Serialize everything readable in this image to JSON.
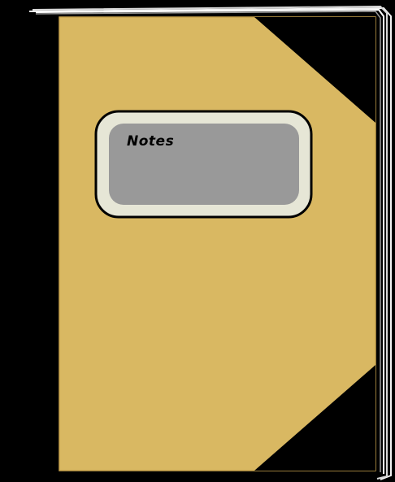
{
  "label": {
    "text": "Notes"
  },
  "colors": {
    "background": "#000000",
    "cover": "#d9b862",
    "cover_edge": "#c9a44e",
    "pages": "#f2f2f2",
    "page_shadow": "#9a9a9a",
    "label_frame": "#e6e6d6",
    "label_panel": "#999999",
    "corner": "#000000"
  }
}
